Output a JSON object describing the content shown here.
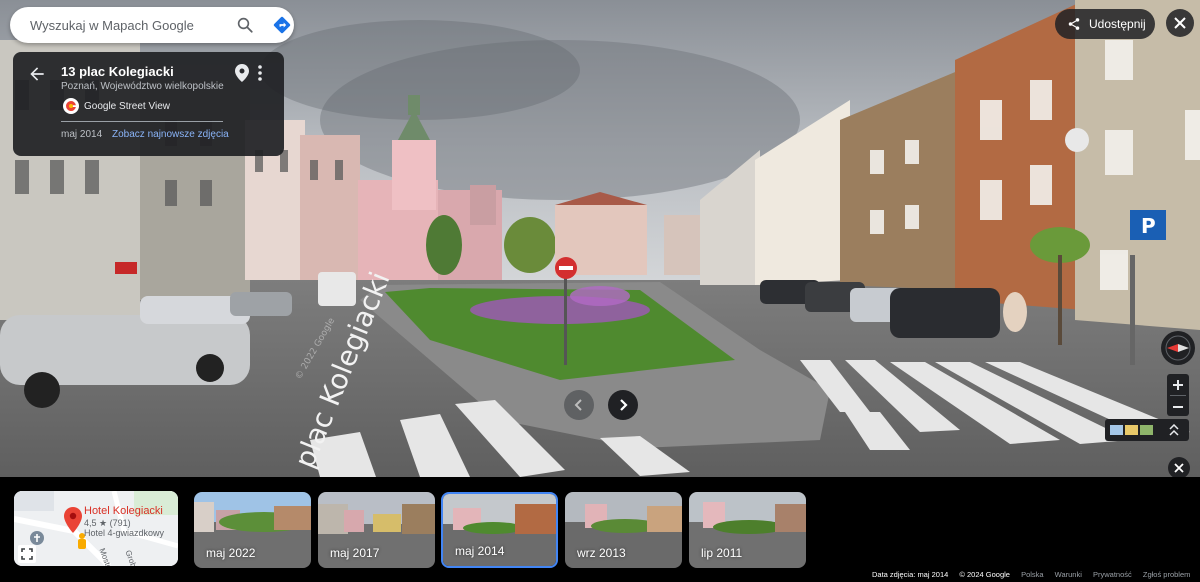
{
  "search": {
    "placeholder": "Wyszukaj w Mapach Google"
  },
  "info": {
    "title": "13 plac Kolegiacki",
    "address": "Poznań, Województwo wielkopolskie",
    "provider": "Google Street View",
    "date": "maj 2014",
    "newest_link": "Zobacz najnowsze zdjęcia"
  },
  "top_right": {
    "share_label": "Udostępnij"
  },
  "scene": {
    "street_label": "plac Kolegiacki",
    "watermark": "© 2022 Google"
  },
  "minimap": {
    "hotel_name": "Hotel Kolegiacki",
    "rating": "4,5 ★ (791)",
    "category": "Hotel 4-gwiazdkowy",
    "street_1": "Mostowa",
    "street_2": "Grobla"
  },
  "timeline": [
    {
      "label": "maj 2022",
      "active": false
    },
    {
      "label": "maj 2017",
      "active": false
    },
    {
      "label": "maj 2014",
      "active": true
    },
    {
      "label": "wrz 2013",
      "active": false
    },
    {
      "label": "lip 2011",
      "active": false
    }
  ],
  "footer": {
    "photo_date": "Data zdjęcia: maj 2014",
    "copyright": "© 2024 Google",
    "country": "Polska",
    "terms": "Warunki",
    "privacy": "Prywatność",
    "report": "Zgłoś problem"
  },
  "colors": {
    "panel": "#202124",
    "accent_blue": "#4285f4",
    "link_blue": "#8ab4f8",
    "map_red": "#d93025",
    "parking_blue": "#1a5fb4"
  },
  "icons": {
    "search": "search-icon",
    "directions": "directions-icon",
    "back": "arrow-back-icon",
    "pin": "location-pin-icon",
    "more": "more-vert-icon",
    "share": "share-icon",
    "close": "close-icon",
    "compass": "compass-icon",
    "prev": "chevron-left-icon",
    "next": "chevron-right-icon"
  }
}
